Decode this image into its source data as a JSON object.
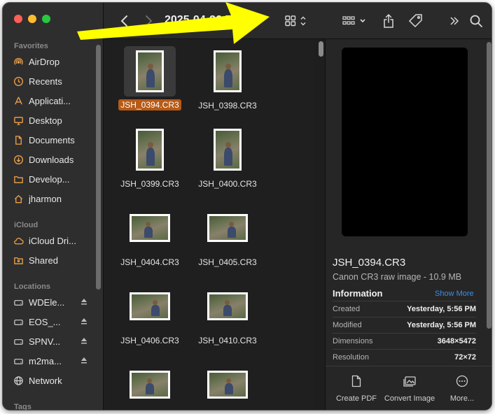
{
  "toolbar": {
    "title": "2025-04-26 E",
    "back_icon": "chevron-left",
    "forward_icon": "chevron-right",
    "view_icon": "grid-view",
    "group_icon": "group-grid",
    "share_icon": "share",
    "tag_icon": "tag",
    "more_icon": "chevron-double-right",
    "search_icon": "magnifier"
  },
  "sidebar": {
    "favorites_header": "Favorites",
    "favorites": [
      {
        "label": "AirDrop",
        "icon": "airdrop"
      },
      {
        "label": "Recents",
        "icon": "clock"
      },
      {
        "label": "Applicati...",
        "icon": "applications"
      },
      {
        "label": "Desktop",
        "icon": "desktop"
      },
      {
        "label": "Documents",
        "icon": "document"
      },
      {
        "label": "Downloads",
        "icon": "download"
      },
      {
        "label": "Develop...",
        "icon": "folder"
      },
      {
        "label": "jharmon",
        "icon": "home"
      }
    ],
    "icloud_header": "iCloud",
    "icloud": [
      {
        "label": "iCloud Dri...",
        "icon": "cloud"
      },
      {
        "label": "Shared",
        "icon": "shared-folder"
      }
    ],
    "locations_header": "Locations",
    "locations": [
      {
        "label": "WDEle...",
        "icon": "drive",
        "eject": true
      },
      {
        "label": "EOS_...",
        "icon": "drive",
        "eject": true
      },
      {
        "label": "SPNV...",
        "icon": "drive",
        "eject": true
      },
      {
        "label": "m2ma...",
        "icon": "drive",
        "eject": true
      },
      {
        "label": "Network",
        "icon": "globe",
        "eject": false
      }
    ],
    "tags_header": "Tags"
  },
  "files": [
    {
      "name": "JSH_0394.CR3",
      "orientation": "portrait",
      "selected": true
    },
    {
      "name": "JSH_0398.CR3",
      "orientation": "portrait",
      "selected": false
    },
    {
      "name": "JSH_0399.CR3",
      "orientation": "portrait",
      "selected": false
    },
    {
      "name": "JSH_0400.CR3",
      "orientation": "portrait",
      "selected": false
    },
    {
      "name": "JSH_0404.CR3",
      "orientation": "landscape",
      "selected": false
    },
    {
      "name": "JSH_0405.CR3",
      "orientation": "landscape",
      "selected": false
    },
    {
      "name": "JSH_0406.CR3",
      "orientation": "landscape",
      "selected": false
    },
    {
      "name": "JSH_0410.CR3",
      "orientation": "landscape",
      "selected": false
    },
    {
      "name": "",
      "orientation": "landscape",
      "selected": false
    },
    {
      "name": "",
      "orientation": "landscape",
      "selected": false
    }
  ],
  "preview": {
    "name": "JSH_0394.CR3",
    "kind": "Canon CR3 raw image - 10.9 MB",
    "info_header": "Information",
    "show_more": "Show More",
    "info": [
      {
        "key": "Created",
        "value": "Yesterday, 5:56 PM"
      },
      {
        "key": "Modified",
        "value": "Yesterday, 5:56 PM"
      },
      {
        "key": "Dimensions",
        "value": "3648×5472"
      },
      {
        "key": "Resolution",
        "value": "72×72"
      }
    ],
    "actions": [
      {
        "label": "Create PDF",
        "icon": "document"
      },
      {
        "label": "Convert Image",
        "icon": "image-convert"
      },
      {
        "label": "More...",
        "icon": "ellipsis-circle"
      }
    ]
  },
  "colors": {
    "selection": "#b65a16",
    "link": "#3b8ee8",
    "sidebar_icon": "#f0a24a",
    "annotation_arrow": "#ffff00"
  }
}
